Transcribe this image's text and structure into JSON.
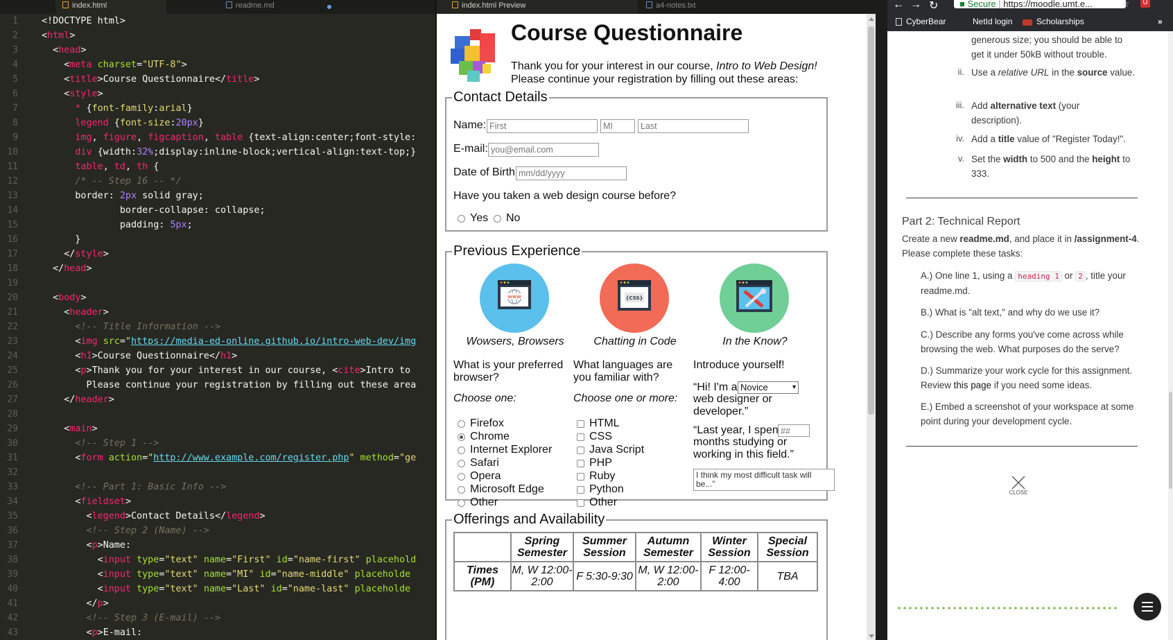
{
  "editor": {
    "tabs": [
      {
        "label": "index.html"
      },
      {
        "label": "readme.md"
      }
    ],
    "line_numbers": [
      "1",
      "2",
      "3",
      "4",
      "5",
      "6",
      "7",
      "8",
      "9",
      "10",
      "11",
      "12",
      "13",
      "14",
      "15",
      "16",
      "17",
      "18",
      "19",
      "20",
      "21",
      "22",
      "23",
      "24",
      "25",
      "26",
      "27",
      "28",
      "29",
      "30",
      "31",
      "32",
      "33",
      "34",
      "35",
      "36",
      "37",
      "38",
      "39",
      "40",
      "41",
      "42",
      "43"
    ]
  },
  "preview_tabs": [
    {
      "label": "index.html Preview"
    },
    {
      "label": "a4-notes.txt"
    }
  ],
  "preview": {
    "title": "Course Questionnaire",
    "intro_before": "Thank you for your interest in our course, ",
    "intro_cite": "Intro to Web Design!",
    "intro_after": "Please continue your registration by filling out these areas:",
    "contact": {
      "legend": "Contact Details",
      "name_label": "Name:",
      "first_placeholder": "First",
      "mi_placeholder": "MI",
      "last_placeholder": "Last",
      "email_label": "E-mail:",
      "email_placeholder": "you@email.com",
      "dob_label": "Date of Birth:",
      "dob_placeholder": "mm/dd/yyyy",
      "course_question": "Have you taken a web design course before?",
      "yes": "Yes",
      "no": "No"
    },
    "experience": {
      "legend": "Previous Experience",
      "col1": {
        "caption": "Wowsers, Browsers",
        "question": "What is your preferred browser?",
        "hint": "Choose one:",
        "options": [
          "Firefox",
          "Chrome",
          "Internet Explorer",
          "Safari",
          "Opera",
          "Microsoft Edge",
          "Other"
        ],
        "selected": "Chrome"
      },
      "col2": {
        "caption": "Chatting in Code",
        "question": "What languages are you familiar with?",
        "hint": "Choose one or more:",
        "options": [
          "HTML",
          "CSS",
          "Java Script",
          "PHP",
          "Ruby",
          "Python",
          "Other"
        ]
      },
      "col3": {
        "caption": "In the Know?",
        "question": "Introduce yourself!",
        "hi_before": "“Hi! I'm a",
        "level_value": "Novice",
        "hi_after": "web designer or developer.”",
        "year_before": "“Last year, I spent",
        "months_placeholder": "##",
        "year_after": "months studying or working in this field.”",
        "textarea_placeholder": "I think my most difficult task will be...”"
      },
      "icon_colors": {
        "browser": "#5bc0eb",
        "code": "#f26b57",
        "know": "#6fcf97"
      }
    },
    "offerings": {
      "legend": "Offerings and Availability",
      "headers": [
        "Spring Semester",
        "Summer Session",
        "Autumn Semester",
        "Winter Session",
        "Special Session"
      ],
      "row_label": "Times (PM)",
      "row": [
        "M, W 12:00-2:00",
        "F 5:30-9:30",
        "M, W 12:00-2:00",
        "F 12:00-4:00",
        "TBA"
      ]
    }
  },
  "browser": {
    "url_secure": "Secure",
    "url": "https://moodle.umt.e...",
    "bookmarks": [
      "CyberBear",
      "NetId login",
      "Scholarships"
    ],
    "content": {
      "top_text": "generous size; you should be able to get it under 50kB without trouble.",
      "steps": [
        {
          "num": "ii.",
          "pre": "Use a ",
          "em": "relative URL",
          "mid": " in the ",
          "b": "source",
          "post": " value."
        },
        {
          "num": "iii.",
          "pre": "Add ",
          "b": "alternative text",
          "post": " (your description)."
        },
        {
          "num": "iv.",
          "pre": "Add a ",
          "b": "title",
          "post": " value of \"Register Today!\"."
        },
        {
          "num": "v.",
          "pre": "Set the ",
          "b": "width",
          "mid": " to 500 and the ",
          "b2": "height",
          "post": " to 333."
        }
      ],
      "part2_title": "Part 2: Technical Report",
      "part2_pre": "Create a new ",
      "part2_file": "readme.md",
      "part2_mid": ", and place it in ",
      "part2_dir": "/assignment-4",
      "part2_post": ". Please complete these tasks:",
      "task_a_pre": "A.) One line 1, using a ",
      "task_a_code1": "heading 1",
      "task_a_or": " or ",
      "task_a_code2": "2",
      "task_a_post": ", title your readme.md.",
      "task_b": "B.) What is \"alt text,\" and why do we use it?",
      "task_c": "C.) Describe any forms you've come across while browsing the web. What purposes do the serve?",
      "task_d_pre": "D.) Summarize your work cycle for this assignment. Review ",
      "task_d_link": "this page",
      "task_d_post": " if you need some ideas.",
      "task_e": "E.) Embed a screenshot of your workspace at some point during your development cycle.",
      "close_label": "CLOSE"
    }
  }
}
